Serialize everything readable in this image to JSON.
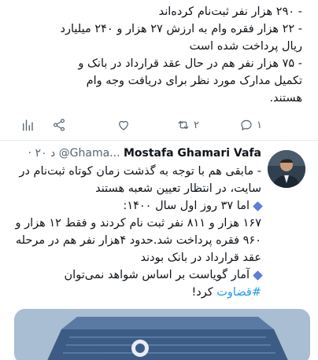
{
  "tweet1": {
    "lines": [
      "- ۲۹۰ هزار نفر ثبت‌نام کرده‌اند",
      "- ۲۲ هزار فقره وام به ارزش ۲۷ هزار و ۲۴۰ میلیارد",
      "ریال پرداخت شده است",
      "- ۷۵ هزار نفر هم در حال عقد قرارداد در بانک و",
      "تکمیل مدارک مورد نظر برای دریافت وجه وام",
      "هستند."
    ],
    "actions": {
      "reply_count": "۱",
      "retweet_count": "۲",
      "like_count": ""
    }
  },
  "tweet2": {
    "author_name": "Mostafa Ghamari Vafa",
    "handle": "@Ghama...",
    "time": "· ۲۰ د",
    "lines": [
      "- مابقی هم با توجه به گذشت زمان کوتاه ثبت‌نام در",
      "سایت، در انتظار تعیین شعبه هستند",
      "اما ۳۷ روز اول سال ۱۴۰۰:",
      "۱۶۷ هزار و ۸۱۱ نفر ثبت نام کردند و فقط ۱۲ هزار و",
      "۹۶۰ فقره پرداخت شد.حدود ۴هزار نفر هم در مرحله",
      "عقد قرارداد در بانک بودند",
      "آمار گویاست بر اساس شواهد نمی‌توان"
    ],
    "hashtag": "#قضاوت",
    "hashtag_suffix": " کرد!"
  },
  "colors": {
    "accent": "#1d9bf0",
    "muted": "#536471",
    "bullet": "#5a7fd6"
  },
  "icons": [
    "reply-icon",
    "retweet-icon",
    "like-icon",
    "share-icon",
    "analytics-icon"
  ]
}
